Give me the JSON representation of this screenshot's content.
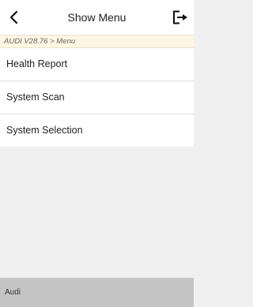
{
  "header": {
    "back_icon": "chevron-left-icon",
    "title": "Show Menu",
    "exit_icon": "exit-icon"
  },
  "breadcrumb": "AUDI V28.76 > Menu",
  "menu": {
    "items": [
      {
        "label": "Health Report"
      },
      {
        "label": "System Scan"
      },
      {
        "label": "System Selection"
      }
    ]
  },
  "footer": {
    "label": "Audi"
  },
  "colors": {
    "breadcrumb_background": "#fdf6e3",
    "content_background": "#f0f0f0",
    "footer_background": "#c4c4c4"
  }
}
